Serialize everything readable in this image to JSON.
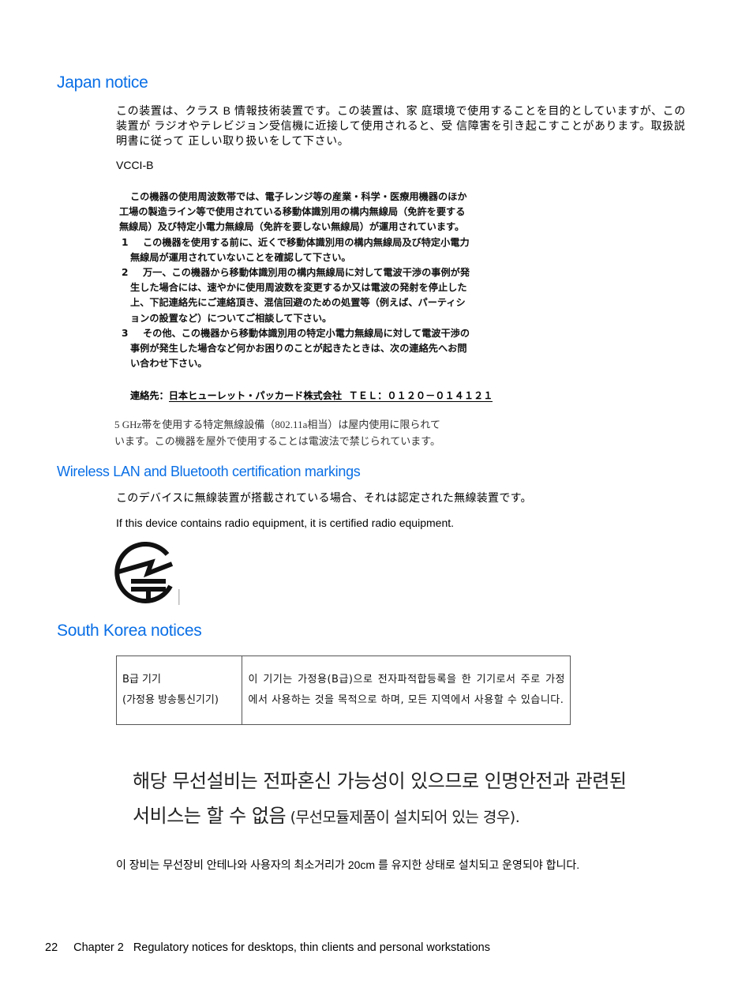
{
  "japan": {
    "heading": "Japan notice",
    "vcci_paragraph": "この装置は、クラス B 情報技術装置です。この装置は、家 庭環境で使用することを目的としていますが、この装置が ラジオやテレビジョン受信機に近接して使用されると、受 信障害を引き起こすことがあります。取扱説明書に従って 正しい取り扱いをして下さい。",
    "vcci_label": "VCCI-B",
    "radio_notice": {
      "intro_lines": [
        "この機器の使用周波数帯では、電子レンジ等の産業・科学・医療用機器のほか",
        "工場の製造ライン等で使用されている移動体識別用の構内無線局（免許を要する",
        "無線局）及び特定小電力無線局（免許を要しない無線局）が運用されています。"
      ],
      "items": [
        {
          "number": "1",
          "lines": [
            "この機器を使用する前に、近くで移動体識別用の構内無線局及び特定小電力",
            "無線局が運用されていないことを確認して下さい。"
          ]
        },
        {
          "number": "2",
          "lines": [
            "万一、この機器から移動体識別用の構内無線局に対して電波干渉の事例が発",
            "生した場合には、速やかに使用周波数を変更するか又は電波の発射を停止した",
            "上、下記連絡先にご連絡頂き、混信回避のための処置等（例えば、パーティシ",
            "ョンの設置など）についてご相談して下さい。"
          ]
        },
        {
          "number": "3",
          "lines": [
            "その他、この機器から移動体識別用の特定小電力無線局に対して電波干渉の",
            "事例が発生した場合など何かお困りのことが起きたときは、次の連絡先へお問",
            "い合わせ下さい。"
          ]
        }
      ],
      "contact_label": "連絡先：",
      "contact_company": "日本ヒューレット・パッカード株式会社",
      "contact_tel": "ＴＥＬ：０１２０－０１４１２１"
    },
    "ghz_note_lines": [
      "5 GHz帯を使用する特定無線設備（802.11a相当）は屋内使用に限られて",
      "います。この機器を屋外で使用することは電波法で禁じられています。"
    ]
  },
  "wireless": {
    "heading": "Wireless LAN and Bluetooth certification markings",
    "jp_text": "このデバイスに無線装置が搭載されている場合、それは認定された無線装置です。",
    "en_text": "If this device contains radio equipment, it is certified radio equipment.",
    "mark_icon": "japan-radio-certification-mark-icon"
  },
  "korea": {
    "heading": "South Korea notices",
    "table": {
      "class_label": "B급 기기",
      "class_sub": "(가정용 방송통신기기)",
      "description": "이 기기는 가정용(B급)으로 전자파적합등록을 한 기기로서 주로 가정에서 사용하는 것을 목적으로 하며, 모든 지역에서 사용할 수 있습니다."
    },
    "big_notice_line1": "해당 무선설비는 전파혼신 가능성이 있으므로 인명안전과 관련된",
    "big_notice_line2_main": "서비스는 할 수 없음",
    "big_notice_line2_paren": " (무선모듈제품이 설치되어 있는 경우).",
    "antenna_note": "이 장비는 무선장비 안테나와 사용자의 최소거리가 20cm 를 유지한 상태로 설치되고 운영되야 합니다."
  },
  "footer": {
    "page_number": "22",
    "chapter": "Chapter 2",
    "title": "Regulatory notices for desktops, thin clients and personal workstations"
  }
}
